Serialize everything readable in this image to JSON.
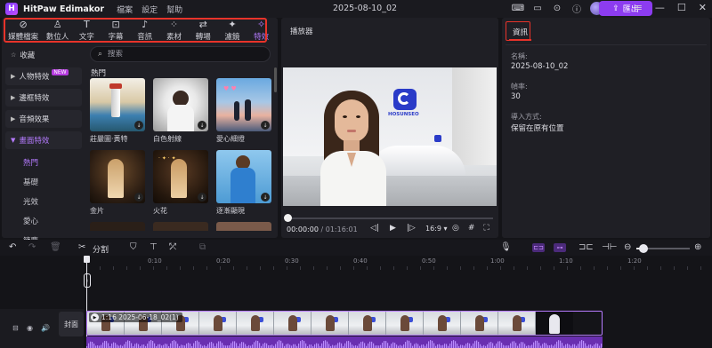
{
  "titlebar": {
    "app_logo": "H",
    "app_name": "HitPaw Edimakor",
    "menu": [
      "檔案",
      "設定",
      "幫助"
    ],
    "project_name": "2025-08-10_02",
    "export_label": "匯出",
    "icons": [
      "keyboard-icon",
      "message-icon",
      "download-icon",
      "info-icon"
    ]
  },
  "toolbar": {
    "items": [
      {
        "label": "媒體檔案",
        "icon": "media-icon",
        "glyph": "⊘",
        "active": false
      },
      {
        "label": "數位人",
        "icon": "avatar-person-icon",
        "glyph": "♙",
        "active": false
      },
      {
        "label": "文字",
        "icon": "text-icon",
        "glyph": "T",
        "active": false
      },
      {
        "label": "字幕",
        "icon": "subtitle-icon",
        "glyph": "⊡",
        "active": false
      },
      {
        "label": "音訊",
        "icon": "music-icon",
        "glyph": "♪",
        "active": false
      },
      {
        "label": "素材",
        "icon": "sticker-icon",
        "glyph": "⁘",
        "active": false
      },
      {
        "label": "轉場",
        "icon": "transition-icon",
        "glyph": "⇄",
        "active": false
      },
      {
        "label": "濾鏡",
        "icon": "filter-icon",
        "glyph": "✦",
        "active": false
      },
      {
        "label": "特效",
        "icon": "effects-icon",
        "glyph": "✧",
        "active": true
      }
    ]
  },
  "categories": {
    "favorites": "收藏",
    "items": [
      "人物特效",
      "邊框特效",
      "音頻效果",
      "畫面特效"
    ],
    "new_badge": "NEW",
    "sub_items": [
      "熱門",
      "基礎",
      "光效",
      "愛心",
      "節慶"
    ]
  },
  "library": {
    "search_placeholder": "搜索",
    "section_title": "熱門",
    "thumbs": [
      {
        "label": "莊嚴圖·黃特"
      },
      {
        "label": "白色射線"
      },
      {
        "label": "愛心細燈"
      },
      {
        "label": "金片"
      },
      {
        "label": "火花"
      },
      {
        "label": "逐漸顯現"
      }
    ]
  },
  "player": {
    "title": "播放器",
    "current_time": "00:00:00",
    "total_time": "/ 01:16:01",
    "aspect_ratio": "16:9",
    "progress": 0,
    "logo_text": "HOSUNSEO"
  },
  "info": {
    "tab": "資訊",
    "fields": [
      {
        "label": "名稱:",
        "value": "2025-08-10_02"
      },
      {
        "label": "幀率:",
        "value": "30"
      },
      {
        "label": "導入方式:",
        "value": "保留在原有位置"
      }
    ]
  },
  "timeline_toolbar": {
    "split_label": "分割",
    "zoom_level": 0.12
  },
  "timeline": {
    "ruler": [
      "0:10",
      "0:20",
      "0:30",
      "0:40",
      "0:50",
      "1:00",
      "1:10",
      "1:20"
    ],
    "clip_label": "1:16 2025-06-18_02(1)",
    "cover_label": "封面"
  },
  "colors": {
    "accent": "#8c3cf0",
    "highlight": "#e8332a",
    "active": "#b57bff"
  }
}
